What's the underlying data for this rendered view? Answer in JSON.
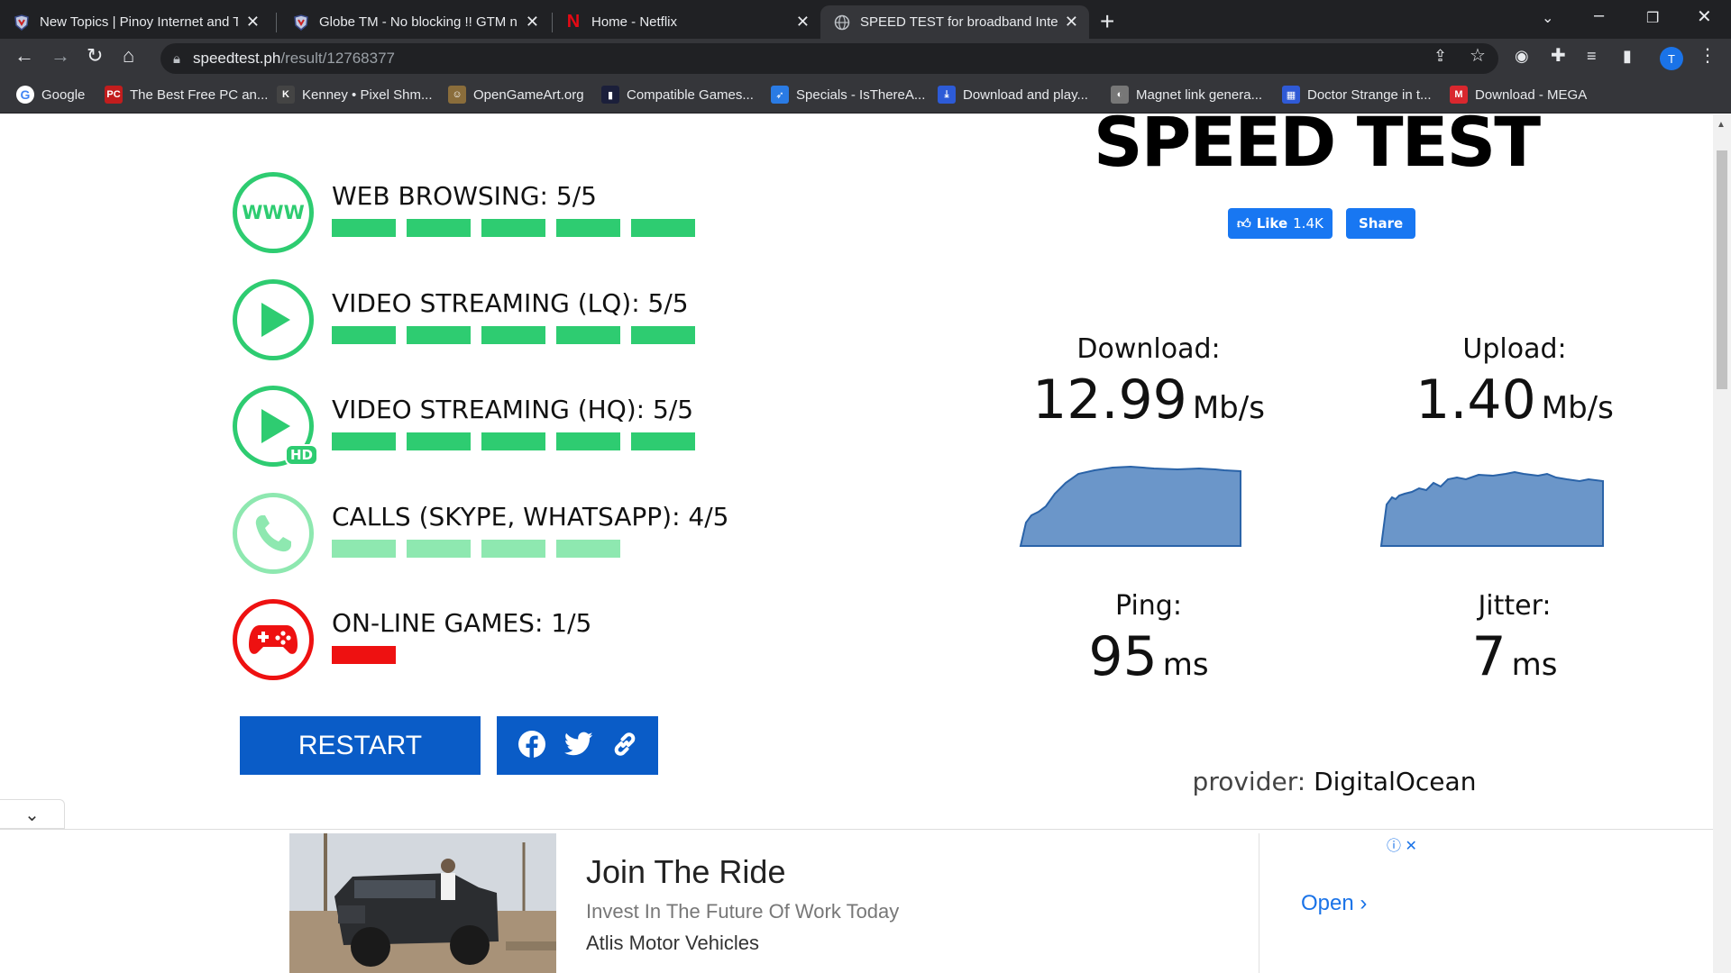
{
  "browser": {
    "tabs": [
      {
        "title": "New Topics | Pinoy Internet and T",
        "icon": "pinoy-favicon"
      },
      {
        "title": "Globe TM - No blocking !! GTM n",
        "icon": "pinoy-favicon"
      },
      {
        "title": "Home - Netflix",
        "icon": "netflix-favicon"
      },
      {
        "title": "SPEED TEST for broadband Intern",
        "icon": "globe-favicon",
        "active": true
      }
    ],
    "url_host": "speedtest.ph",
    "url_path": "/result/12768377",
    "profile_initial": "T",
    "bookmarks": [
      {
        "label": "Google",
        "icon": "google-icon"
      },
      {
        "label": "The Best Free PC an...",
        "icon": "pc-icon"
      },
      {
        "label": "Kenney • Pixel Shm...",
        "icon": "kenney-icon"
      },
      {
        "label": "OpenGameArt.org",
        "icon": "oga-icon"
      },
      {
        "label": "Compatible Games...",
        "icon": "games-icon"
      },
      {
        "label": "Specials - IsThereA...",
        "icon": "rocket-icon"
      },
      {
        "label": "Download and play...",
        "icon": "download-icon"
      },
      {
        "label": "Magnet link genera...",
        "icon": "magnet-icon"
      },
      {
        "label": "Doctor Strange in t...",
        "icon": "calendar-icon"
      },
      {
        "label": "Download - MEGA",
        "icon": "mega-icon"
      }
    ]
  },
  "ratings": [
    {
      "label": "WEB BROWSING: 5/5",
      "score": 5,
      "icon": "www-icon",
      "color": "#2ecc71"
    },
    {
      "label": "VIDEO STREAMING (LQ): 5/5",
      "score": 5,
      "icon": "play-icon",
      "color": "#2ecc71"
    },
    {
      "label": "VIDEO STREAMING (HQ): 5/5",
      "score": 5,
      "icon": "play-hd-icon",
      "color": "#2ecc71"
    },
    {
      "label": "CALLS (SKYPE, WHATSAPP): 4/5",
      "score": 4,
      "icon": "phone-icon",
      "color": "#8ee8b0"
    },
    {
      "label": "ON-LINE GAMES: 1/5",
      "score": 1,
      "icon": "gamepad-icon",
      "color": "#ee1111"
    }
  ],
  "www_text": "WWW",
  "hd_text": "HD",
  "restart_label": "RESTART",
  "title": "SPEED TEST",
  "fb": {
    "like_label": "Like",
    "like_count": "1.4K",
    "share_label": "Share"
  },
  "metrics": {
    "download": {
      "label": "Download:",
      "value": "12.99",
      "unit": "Mb/s"
    },
    "upload": {
      "label": "Upload:",
      "value": "1.40",
      "unit": "Mb/s"
    },
    "ping": {
      "label": "Ping:",
      "value": "95",
      "unit": "ms"
    },
    "jitter": {
      "label": "Jitter:",
      "value": "7",
      "unit": "ms"
    }
  },
  "provider": {
    "label": "provider:",
    "name": "DigitalOcean"
  },
  "ad": {
    "title": "Join The Ride",
    "subtitle": "Invest In The Future Of Work Today",
    "brand": "Atlis Motor Vehicles",
    "cta": "Open"
  },
  "colors": {
    "accent_blue": "#0a5cc7",
    "graph_fill": "#6b96c9",
    "graph_stroke": "#2a63a8"
  }
}
